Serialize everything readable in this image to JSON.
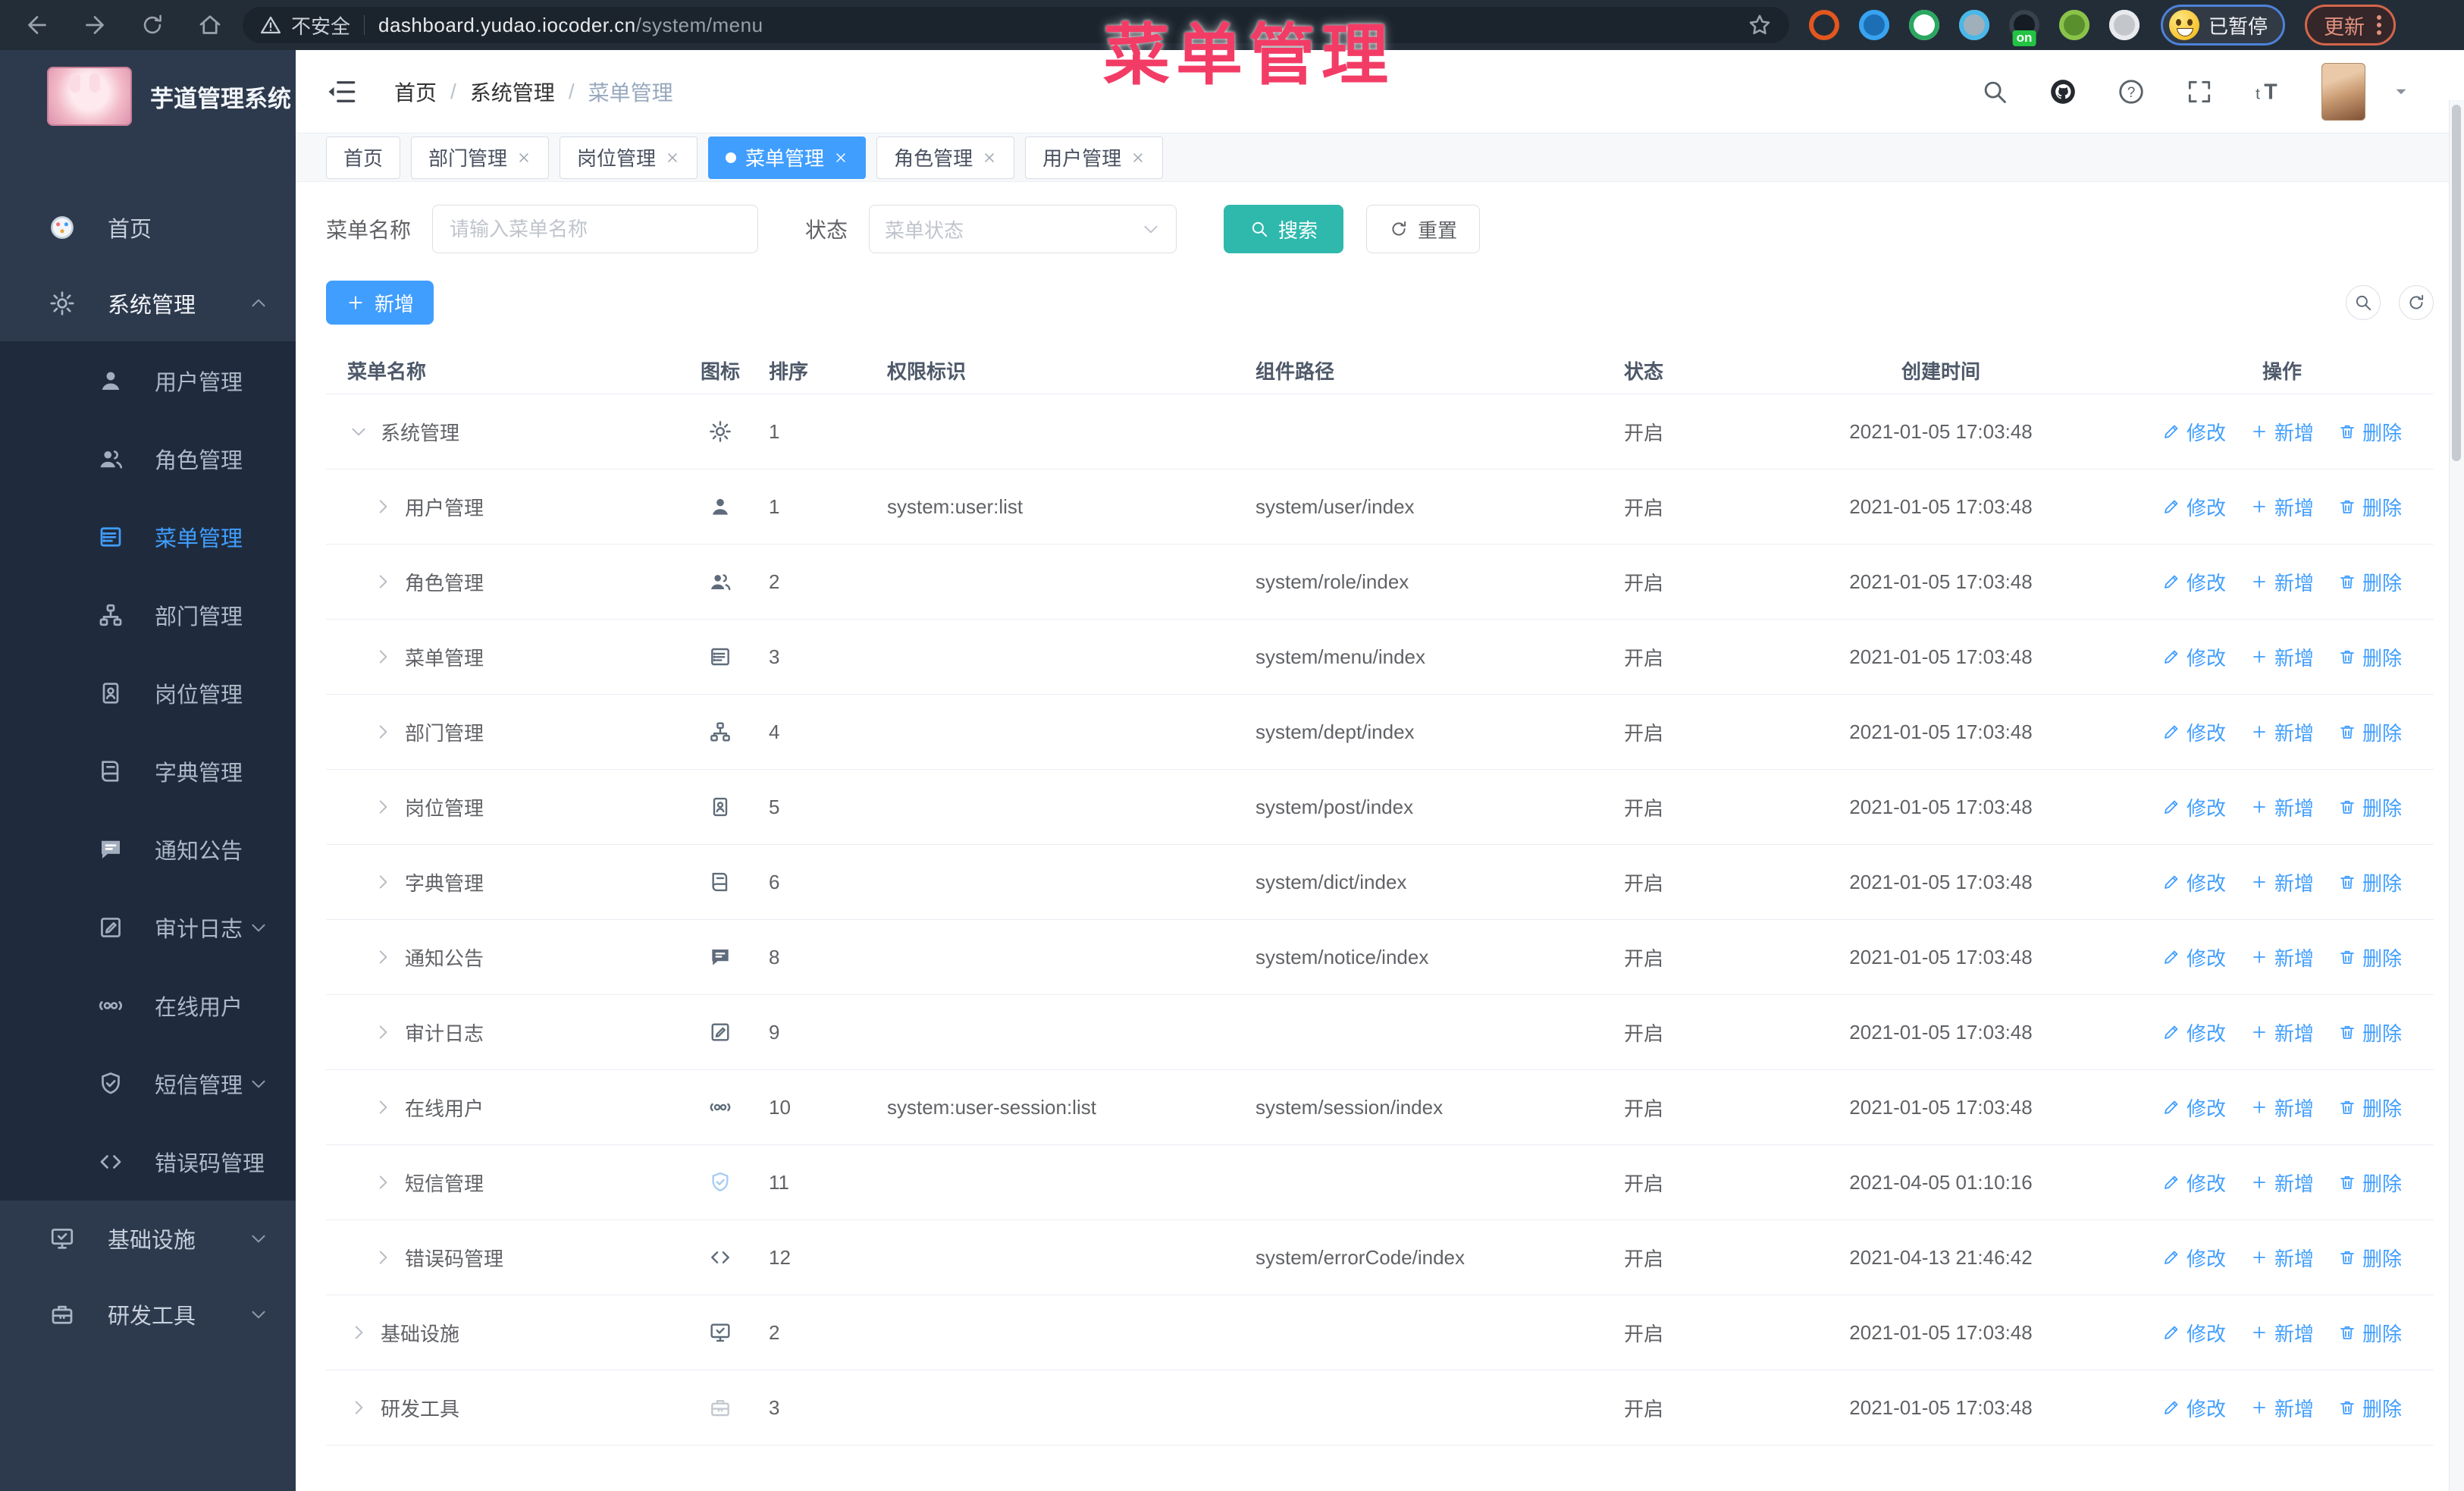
{
  "annotation": {
    "text": "菜单管理",
    "color": "#f23c66"
  },
  "browser": {
    "security_label": "不安全",
    "url_host": "dashboard.yudao.iocoder.cn",
    "url_path": "/system/menu",
    "profile_badge": "已暂停",
    "update_label": "更新",
    "extensions": [
      {
        "name": "ext-orange-ring-icon",
        "color": "#e2571f",
        "inner": "#232d38"
      },
      {
        "name": "ext-blue-gem-icon",
        "color": "#38a3f1",
        "inner": "#1c6fb4"
      },
      {
        "name": "ext-green-check-icon",
        "color": "#2aa760",
        "inner": "#ffffff"
      },
      {
        "name": "ext-blue-blocks-icon",
        "color": "#49b8e8",
        "inner": "#9fb0ba"
      },
      {
        "name": "ext-stack-on-icon",
        "color": "#38424c",
        "inner": "#151c23",
        "badge": "on"
      },
      {
        "name": "ext-green-droid-icon",
        "color": "#8bc34a",
        "inner": "#5a8f2e"
      },
      {
        "name": "ext-puzzle-icon",
        "color": "#e8eaed",
        "inner": "#c3c7cc"
      }
    ]
  },
  "sidebar": {
    "title": "芋道管理系统",
    "items": [
      {
        "label": "首页",
        "icon": "dashboard",
        "level": 1
      },
      {
        "label": "系统管理",
        "icon": "gear",
        "level": 1,
        "chevron": "up",
        "parent_active": true
      },
      {
        "label": "用户管理",
        "icon": "user",
        "level": 2
      },
      {
        "label": "角色管理",
        "icon": "users",
        "level": 2
      },
      {
        "label": "菜单管理",
        "icon": "menu-list",
        "level": 2,
        "active": true
      },
      {
        "label": "部门管理",
        "icon": "org-tree",
        "level": 2
      },
      {
        "label": "岗位管理",
        "icon": "id-badge",
        "level": 2
      },
      {
        "label": "字典管理",
        "icon": "dict-book",
        "level": 2
      },
      {
        "label": "通知公告",
        "icon": "message",
        "level": 2
      },
      {
        "label": "审计日志",
        "icon": "audit-log",
        "level": 2,
        "chevron": "down"
      },
      {
        "label": "在线用户",
        "icon": "online-link",
        "level": 2
      },
      {
        "label": "短信管理",
        "icon": "shield-check",
        "level": 2,
        "chevron": "down"
      },
      {
        "label": "错误码管理",
        "icon": "code",
        "level": 2
      },
      {
        "label": "基础设施",
        "icon": "monitor",
        "level": 1,
        "chevron": "down"
      },
      {
        "label": "研发工具",
        "icon": "toolbox",
        "level": 1,
        "chevron": "down"
      }
    ]
  },
  "header": {
    "breadcrumb": [
      "首页",
      "系统管理",
      "菜单管理"
    ],
    "separator": "/"
  },
  "tabs": [
    {
      "label": "首页",
      "closable": false,
      "active": false
    },
    {
      "label": "部门管理",
      "closable": true,
      "active": false
    },
    {
      "label": "岗位管理",
      "closable": true,
      "active": false
    },
    {
      "label": "菜单管理",
      "closable": true,
      "active": true
    },
    {
      "label": "角色管理",
      "closable": true,
      "active": false
    },
    {
      "label": "用户管理",
      "closable": true,
      "active": false
    }
  ],
  "filters": {
    "name_label": "菜单名称",
    "name_placeholder": "请输入菜单名称",
    "status_label": "状态",
    "status_placeholder": "菜单状态",
    "search_label": "搜索",
    "reset_label": "重置"
  },
  "toolbar": {
    "add_label": "新增"
  },
  "table": {
    "columns": [
      "菜单名称",
      "图标",
      "排序",
      "权限标识",
      "组件路径",
      "状态",
      "创建时间",
      "操作"
    ],
    "actions": {
      "edit": "修改",
      "add": "新增",
      "delete": "删除"
    },
    "rows": [
      {
        "name": "系统管理",
        "icon": "gear",
        "level": 1,
        "chevron": "down",
        "order": "1",
        "perm": "",
        "path": "",
        "status": "开启",
        "time": "2021-01-05 17:03:48"
      },
      {
        "name": "用户管理",
        "icon": "user",
        "level": 2,
        "chevron": "right",
        "order": "1",
        "perm": "system:user:list",
        "path": "system/user/index",
        "status": "开启",
        "time": "2021-01-05 17:03:48"
      },
      {
        "name": "角色管理",
        "icon": "users",
        "level": 2,
        "chevron": "right",
        "order": "2",
        "perm": "",
        "path": "system/role/index",
        "status": "开启",
        "time": "2021-01-05 17:03:48"
      },
      {
        "name": "菜单管理",
        "icon": "menu-list",
        "level": 2,
        "chevron": "right",
        "order": "3",
        "perm": "",
        "path": "system/menu/index",
        "status": "开启",
        "time": "2021-01-05 17:03:48"
      },
      {
        "name": "部门管理",
        "icon": "org-tree",
        "level": 2,
        "chevron": "right",
        "order": "4",
        "perm": "",
        "path": "system/dept/index",
        "status": "开启",
        "time": "2021-01-05 17:03:48"
      },
      {
        "name": "岗位管理",
        "icon": "id-badge",
        "level": 2,
        "chevron": "right",
        "order": "5",
        "perm": "",
        "path": "system/post/index",
        "status": "开启",
        "time": "2021-01-05 17:03:48"
      },
      {
        "name": "字典管理",
        "icon": "dict-book",
        "level": 2,
        "chevron": "right",
        "order": "6",
        "perm": "",
        "path": "system/dict/index",
        "status": "开启",
        "time": "2021-01-05 17:03:48"
      },
      {
        "name": "通知公告",
        "icon": "message",
        "level": 2,
        "chevron": "right",
        "order": "8",
        "perm": "",
        "path": "system/notice/index",
        "status": "开启",
        "time": "2021-01-05 17:03:48"
      },
      {
        "name": "审计日志",
        "icon": "audit-log",
        "level": 2,
        "chevron": "right",
        "order": "9",
        "perm": "",
        "path": "",
        "status": "开启",
        "time": "2021-01-05 17:03:48"
      },
      {
        "name": "在线用户",
        "icon": "online-link",
        "level": 2,
        "chevron": "right",
        "order": "10",
        "perm": "system:user-session:list",
        "path": "system/session/index",
        "status": "开启",
        "time": "2021-01-05 17:03:48"
      },
      {
        "name": "短信管理",
        "icon": "shield-check",
        "level": 2,
        "chevron": "right",
        "order": "11",
        "perm": "",
        "path": "",
        "status": "开启",
        "time": "2021-04-05 01:10:16",
        "icon_style": "muted"
      },
      {
        "name": "错误码管理",
        "icon": "code",
        "level": 2,
        "chevron": "right",
        "order": "12",
        "perm": "",
        "path": "system/errorCode/index",
        "status": "开启",
        "time": "2021-04-13 21:46:42"
      },
      {
        "name": "基础设施",
        "icon": "monitor",
        "level": 1,
        "chevron": "right",
        "order": "2",
        "perm": "",
        "path": "",
        "status": "开启",
        "time": "2021-01-05 17:03:48"
      },
      {
        "name": "研发工具",
        "icon": "toolbox",
        "level": 1,
        "chevron": "right",
        "order": "3",
        "perm": "",
        "path": "",
        "status": "开启",
        "time": "2021-01-05 17:03:48",
        "icon_style": "muted2"
      }
    ]
  },
  "colors": {
    "primary": "#409eff",
    "teal": "#2fb9ad",
    "sidebar_bg": "#2d3a4d",
    "submenu_bg": "#1f2b3d",
    "annotation": "#f23c66"
  }
}
